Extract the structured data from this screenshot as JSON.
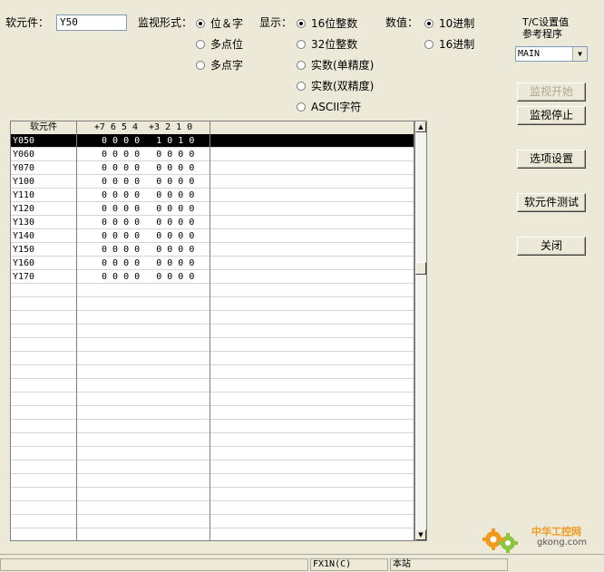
{
  "device": {
    "label": "软元件：",
    "value": "Y50"
  },
  "monitor_mode": {
    "label": "监视形式：",
    "options": [
      "位＆字",
      "多点位",
      "多点字"
    ],
    "selected": 0
  },
  "display": {
    "label": "显示：",
    "options": [
      "16位整数",
      "32位整数",
      "实数(单精度)",
      "实数(双精度)",
      "ASCII字符"
    ],
    "selected": 0
  },
  "number": {
    "label": "数值：",
    "options": [
      "10进制",
      "16进制"
    ],
    "selected": 0
  },
  "tc": {
    "line1": "T/C设置值",
    "line2": "参考程序",
    "value": "MAIN"
  },
  "buttons": {
    "start": "监视开始",
    "stop": "监视停止",
    "options": "选项设置",
    "test": "软元件测试",
    "close": "关闭"
  },
  "table": {
    "headers": [
      "软元件",
      "+7 6 5 4  +3 2 1 0"
    ],
    "rows": [
      {
        "device": "Y050",
        "bits": "0 0 0 0   1 0 1 0"
      },
      {
        "device": "Y060",
        "bits": "0 0 0 0   0 0 0 0"
      },
      {
        "device": "Y070",
        "bits": "0 0 0 0   0 0 0 0"
      },
      {
        "device": "Y100",
        "bits": "0 0 0 0   0 0 0 0"
      },
      {
        "device": "Y110",
        "bits": "0 0 0 0   0 0 0 0"
      },
      {
        "device": "Y120",
        "bits": "0 0 0 0   0 0 0 0"
      },
      {
        "device": "Y130",
        "bits": "0 0 0 0   0 0 0 0"
      },
      {
        "device": "Y140",
        "bits": "0 0 0 0   0 0 0 0"
      },
      {
        "device": "Y150",
        "bits": "0 0 0 0   0 0 0 0"
      },
      {
        "device": "Y160",
        "bits": "0 0 0 0   0 0 0 0"
      },
      {
        "device": "Y170",
        "bits": "0 0 0 0   0 0 0 0"
      }
    ]
  },
  "status": {
    "plc": "FX1N(C)",
    "station": "本站"
  },
  "watermark": {
    "brand": "中华工控网",
    "url": "gkong.com"
  }
}
